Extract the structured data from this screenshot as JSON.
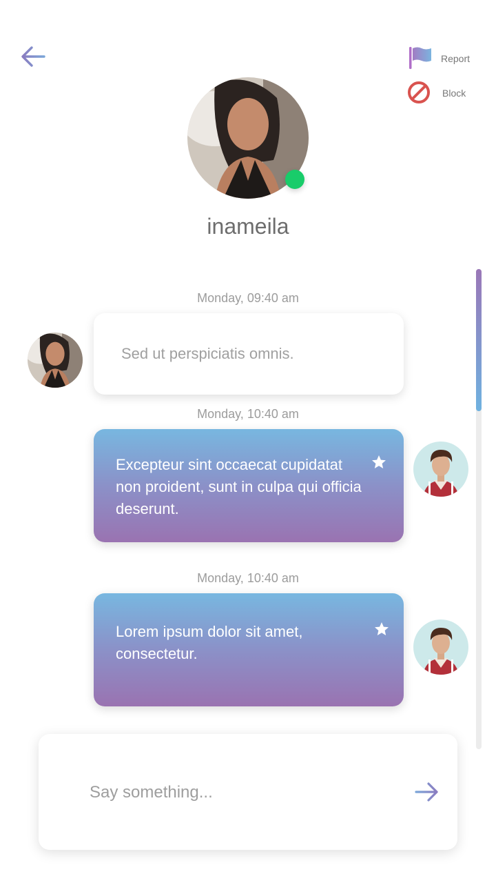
{
  "header": {
    "back_icon": "arrow-left-icon",
    "report_label": "Report",
    "report_icon": "flag-icon",
    "block_label": "Block",
    "block_icon": "block-icon"
  },
  "profile": {
    "username": "inameila",
    "online": true,
    "online_color": "#19cc6a"
  },
  "messages": [
    {
      "timestamp": "Monday, 09:40 am",
      "direction": "incoming",
      "text": "Sed ut perspiciatis omnis.",
      "starred": false
    },
    {
      "timestamp": "Monday, 10:40 am",
      "direction": "outgoing",
      "text": "Excepteur sint occaecat cupidatat non proident, sunt in culpa qui officia deserunt.",
      "starred": true
    },
    {
      "timestamp": "Monday, 10:40 am",
      "direction": "outgoing",
      "text": "Lorem ipsum dolor sit amet, consectetur.",
      "starred": true
    }
  ],
  "composer": {
    "placeholder": "Say something...",
    "value": "",
    "send_icon": "arrow-right-icon"
  },
  "colors": {
    "accent_gradient_top": "#78b7e0",
    "accent_gradient_bottom": "#9a73b1",
    "block_red": "#d9534f"
  }
}
